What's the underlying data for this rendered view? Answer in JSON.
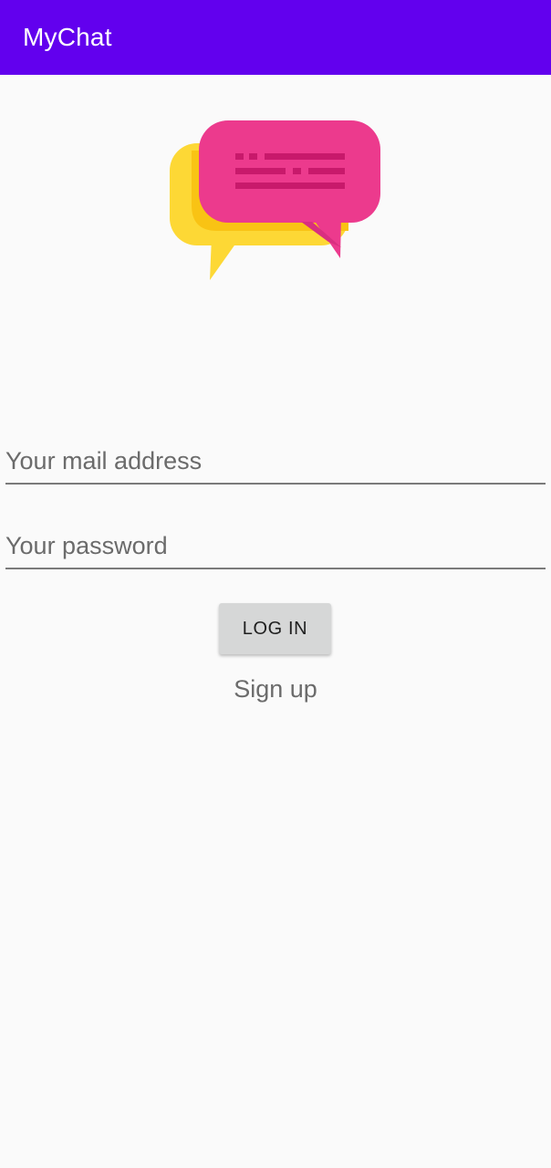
{
  "app_bar": {
    "title": "MyChat",
    "color": "#6200ee"
  },
  "logo": {
    "icon": "chat-bubbles-icon",
    "colors": {
      "back_bubble": "#fdd835",
      "back_bubble_shadow": "#f9c314",
      "front_bubble": "#ec3a8d",
      "lines": "#c8196b"
    }
  },
  "form": {
    "email_placeholder": "Your mail address",
    "email_value": "",
    "password_placeholder": "Your password",
    "password_value": "",
    "login_label": "LOG IN",
    "signup_label": "Sign up"
  }
}
